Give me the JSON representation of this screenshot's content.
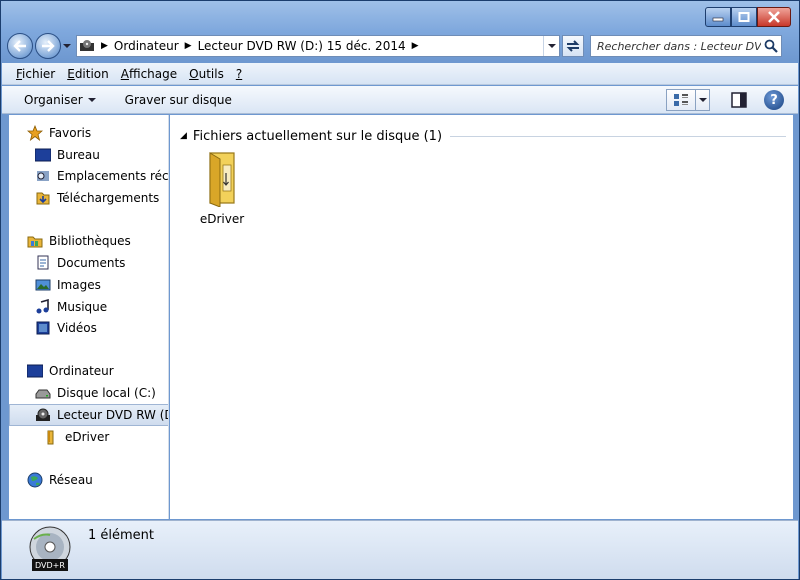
{
  "window": {
    "caption": {
      "minimize": "minimize",
      "maximize": "maximize",
      "close": "close"
    }
  },
  "address": {
    "crumbs": [
      "Ordinateur",
      "Lecteur DVD RW (D:) 15 déc. 2014"
    ]
  },
  "search": {
    "placeholder": "Rechercher dans : Lecteur DV..."
  },
  "menubar": {
    "items": [
      {
        "u": "F",
        "rest": "ichier"
      },
      {
        "u": "E",
        "rest": "dition"
      },
      {
        "u": "A",
        "rest": "ffichage"
      },
      {
        "u": "O",
        "rest": "utils"
      },
      {
        "u": "?",
        "rest": ""
      }
    ]
  },
  "toolbar": {
    "organize": "Organiser",
    "burn": "Graver sur disque",
    "help": "?"
  },
  "sidebar": {
    "favorites": "Favoris",
    "fav_items": [
      "Bureau",
      "Emplacements récents",
      "Téléchargements"
    ],
    "libraries": "Bibliothèques",
    "lib_items": [
      "Documents",
      "Images",
      "Musique",
      "Vidéos"
    ],
    "computer": "Ordinateur",
    "comp_items": [
      "Disque local (C:)",
      "Lecteur DVD RW (D:)"
    ],
    "sub_items": [
      "eDriver"
    ],
    "network": "Réseau"
  },
  "content": {
    "group_title": "Fichiers actuellement sur le disque (1)",
    "files": [
      {
        "name": "eDriver",
        "icon": "folder-icon"
      }
    ]
  },
  "status": {
    "drive_label": "DVD+R",
    "count": "1 élément"
  }
}
